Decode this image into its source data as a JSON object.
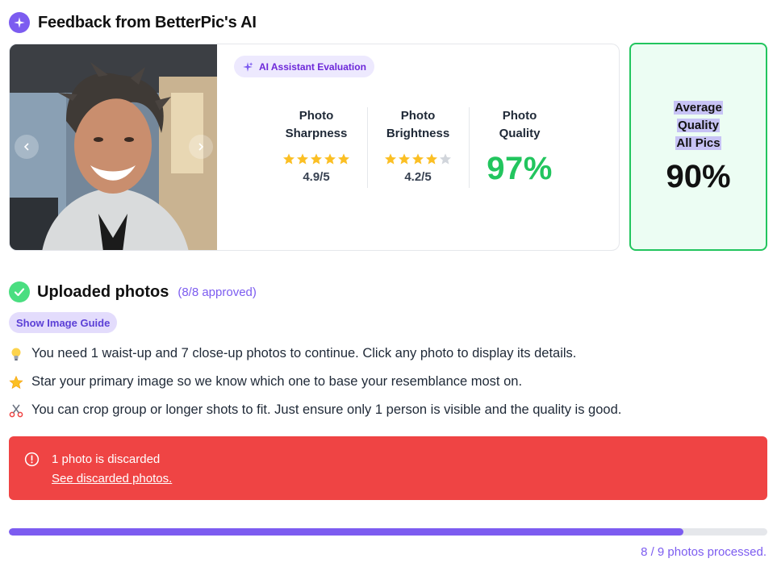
{
  "header": {
    "title": "Feedback from BetterPic's AI",
    "icon": "sparkle-icon"
  },
  "feedback": {
    "badge": "AI Assistant Evaluation",
    "photo": {
      "alt": "Smiling man with messy hair in a light grey zip sweater"
    },
    "metrics": [
      {
        "title_line1": "Photo",
        "title_line2": "Sharpness",
        "stars": 5,
        "value": "4.9/5"
      },
      {
        "title_line1": "Photo",
        "title_line2": "Brightness",
        "stars": 4,
        "value": "4.2/5"
      },
      {
        "title_line1": "Photo",
        "title_line2": "Quality",
        "value": "97%"
      }
    ]
  },
  "average": {
    "line1": "Average",
    "line2": "Quality",
    "line3": "All Pics",
    "value": "90%"
  },
  "uploads": {
    "title": "Uploaded photos",
    "count": "(8/8 approved)",
    "guide_button": "Show Image Guide",
    "tips": [
      {
        "icon": "lightbulb-icon",
        "text": "You need 1 waist-up and 7 close-up photos to continue. Click any photo to display its details."
      },
      {
        "icon": "star-icon",
        "text": "Star your primary image so we know which one to base your resemblance most on."
      },
      {
        "icon": "scissors-icon",
        "text": "You can crop group or longer shots to fit. Just ensure only 1 person is visible and the quality is good."
      }
    ]
  },
  "alert": {
    "message": "1 photo is discarded",
    "link": "See discarded photos."
  },
  "progress": {
    "processed": 8,
    "total": 9,
    "text": "8 / 9 photos processed."
  },
  "colors": {
    "accent": "#7c5cf0",
    "success": "#22c55e",
    "danger": "#ef4444",
    "star": "#fbbf24"
  }
}
